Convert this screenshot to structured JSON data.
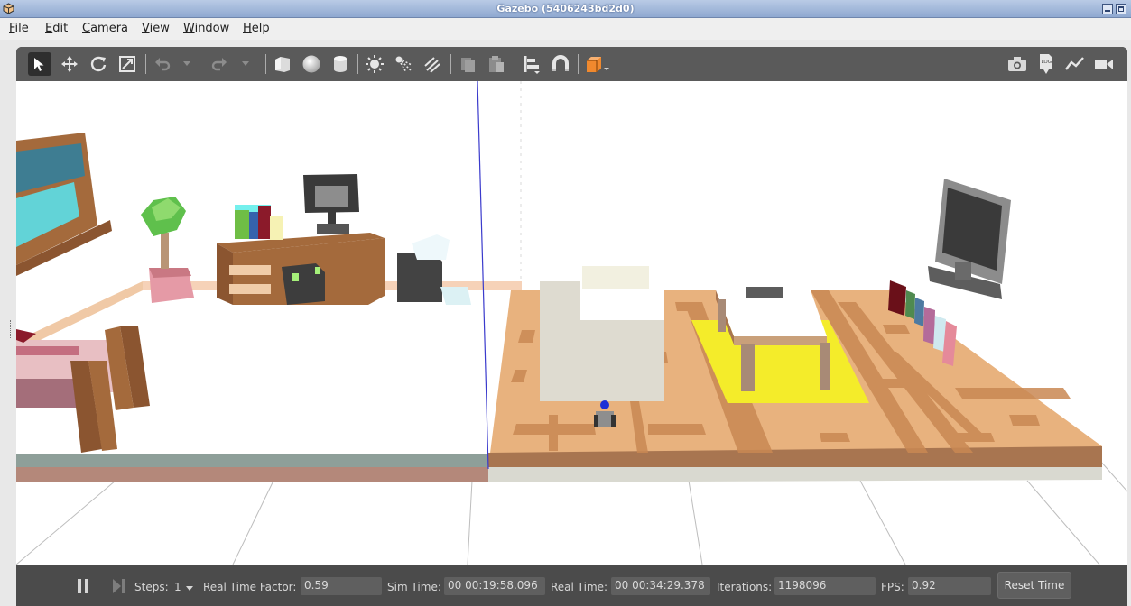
{
  "window": {
    "title": "Gazebo (5406243bd2d0)"
  },
  "menu": {
    "items": [
      "File",
      "Edit",
      "Camera",
      "View",
      "Window",
      "Help"
    ]
  },
  "toolbar": {
    "left_tools": [
      "select-arrow-icon",
      "translate-icon",
      "rotate-icon",
      "scale-icon",
      "undo-icon",
      "undo-dropdown-icon",
      "redo-icon",
      "redo-dropdown-icon",
      "box-shape-icon",
      "sphere-shape-icon",
      "cylinder-shape-icon",
      "point-light-icon",
      "spot-light-icon",
      "directional-light-icon",
      "copy-icon",
      "paste-icon",
      "align-icon",
      "magnet-snap-icon",
      "view-angle-icon"
    ],
    "right_tools": [
      "screenshot-icon",
      "log-icon",
      "plot-icon",
      "video-record-icon"
    ],
    "accent": "#f0892e"
  },
  "status": {
    "steps_label": "Steps:",
    "steps_value": "1",
    "rtf_label": "Real Time Factor:",
    "rtf_value": "0.59",
    "sim_time_label": "Sim Time:",
    "sim_time_value": "00 00:19:58.096",
    "real_time_label": "Real Time:",
    "real_time_value": "00 00:34:29.378",
    "iterations_label": "Iterations:",
    "iterations_value": "1198096",
    "fps_label": "FPS:",
    "fps_value": "0.92",
    "reset_label": "Reset Time"
  },
  "colors": {
    "floor_wood": "#e8b27e",
    "rug": "#f4ec2a",
    "axis_line": "#3a3acc"
  }
}
